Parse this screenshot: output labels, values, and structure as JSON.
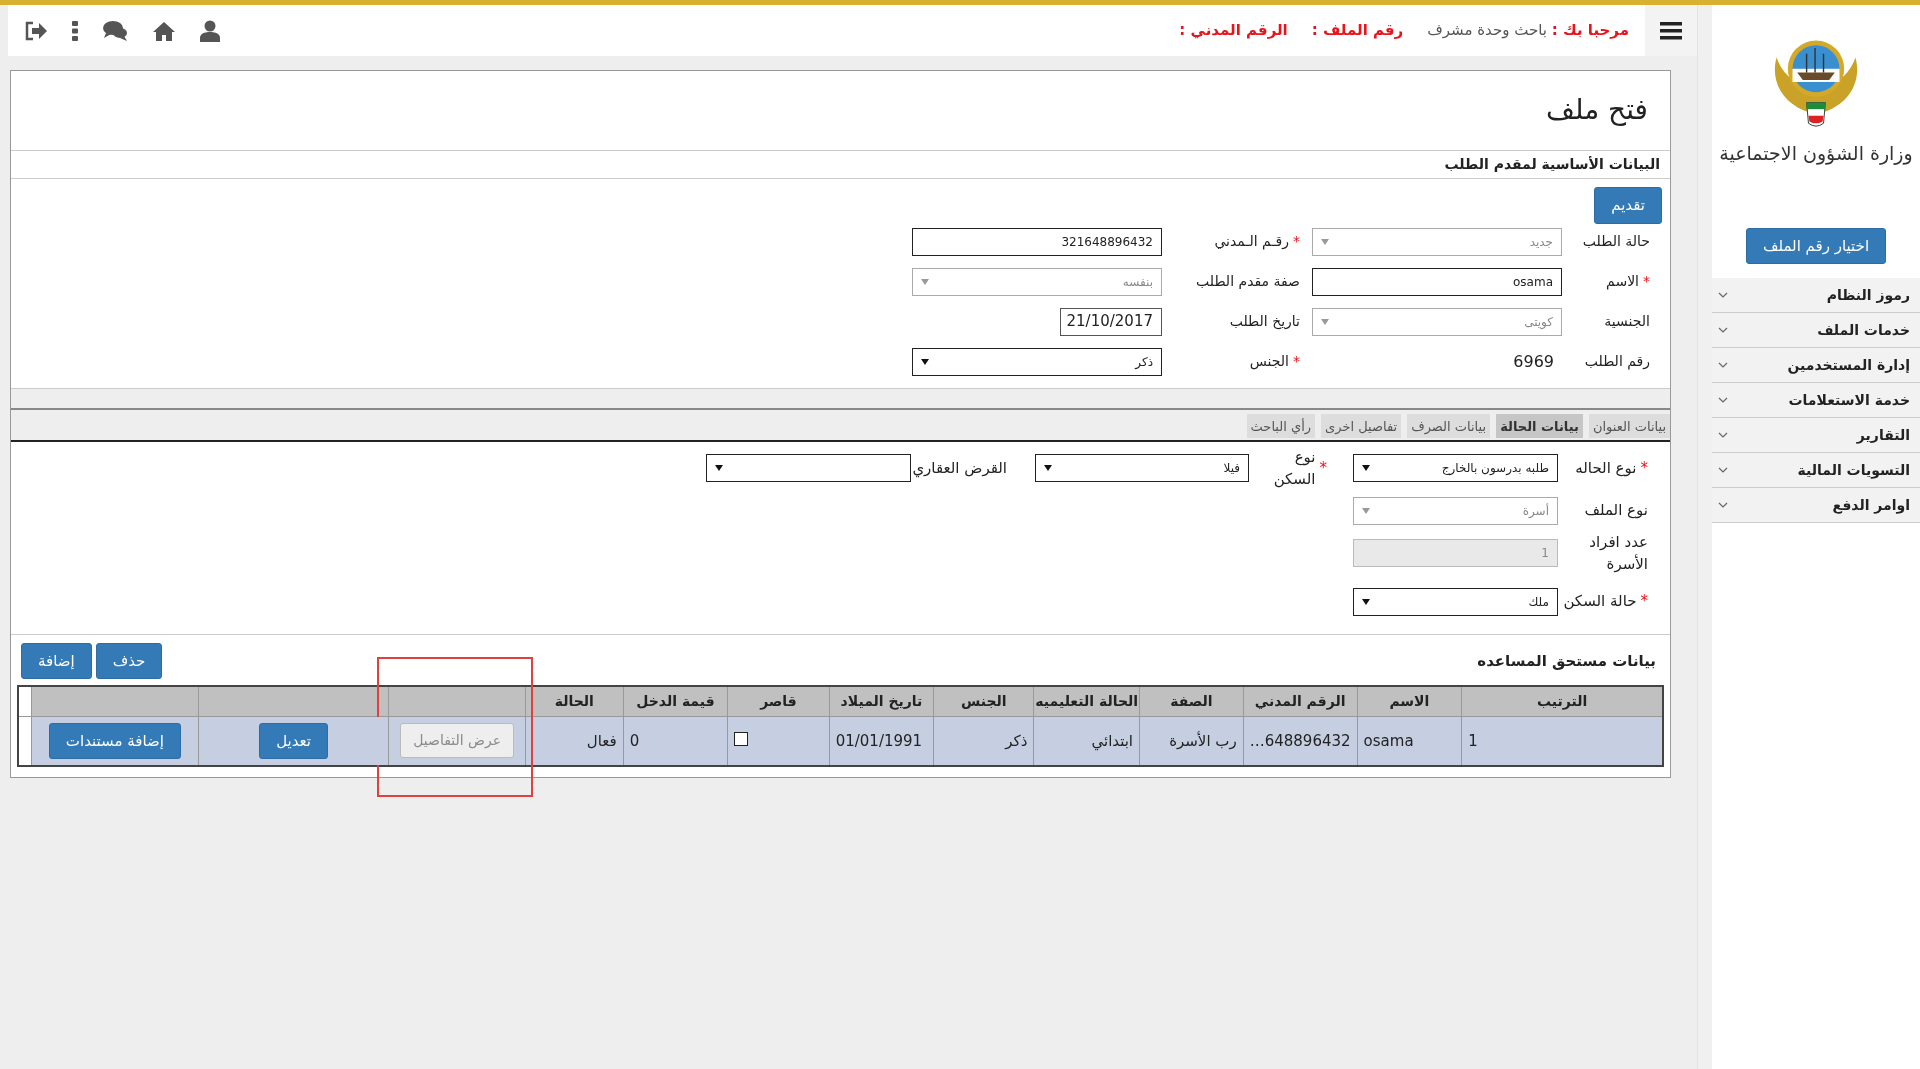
{
  "top_bar": {
    "welcome_label": "مرحبا بك :",
    "user_role": "باحث وحدة مشرف",
    "file_number_label": "رقم الملف :",
    "civil_id_label": "الرقم المدني :"
  },
  "sidebar": {
    "ministry_name": "وزارة الشؤون الاجتماعية",
    "select_file_button": "اختيار رقم الملف",
    "menu": [
      {
        "label": "رموز النظام"
      },
      {
        "label": "خدمات الملف"
      },
      {
        "label": "إدارة المستخدمين"
      },
      {
        "label": "خدمة الاستعلامات"
      },
      {
        "label": "التقارير"
      },
      {
        "label": "التسويات المالية"
      },
      {
        "label": "اوامر الدفع"
      }
    ]
  },
  "page": {
    "title": "فتح ملف",
    "section_title": "البيانات الأساسية لمقدم الطلب",
    "submit_button": "تقديم",
    "fields": [
      {
        "label": "حالة الطلب",
        "kind": "select",
        "value": "جديد",
        "disabled": true
      },
      {
        "label": "رقـم الـمدني",
        "required_mark": "*",
        "kind": "input",
        "value": "321648896432",
        "disabled": false
      },
      {
        "label": "الاسم",
        "required_mark": "*",
        "kind": "input",
        "value": "osama",
        "disabled": false
      },
      {
        "label": "صفة مقدم الطلب",
        "kind": "select",
        "value": "بنفسه",
        "disabled": true
      },
      {
        "label": "الجنسية",
        "kind": "select",
        "value": "كويتى",
        "disabled": true
      },
      {
        "label": "تاريخ الطلب",
        "kind": "date",
        "value": "21/10/2017"
      },
      {
        "label": "رقم الطلب",
        "kind": "static",
        "value": "6969"
      },
      {
        "label": "الجنس",
        "required_mark": "*",
        "kind": "select",
        "value": "ذكر",
        "disabled": false
      }
    ]
  },
  "tabs": [
    {
      "label": "بيانات العنوان",
      "selected": false
    },
    {
      "label": "بيانات الحالة",
      "selected": true
    },
    {
      "label": "بيانات الصرف",
      "selected": false
    },
    {
      "label": "تفاصيل اخرى",
      "selected": false
    },
    {
      "label": "رأي الباحث",
      "selected": false
    }
  ],
  "case_fields": [
    [
      {
        "label": "نوع الحاله",
        "required_mark": "*",
        "kind": "select",
        "value": "طلبه بدرسون بالخارج",
        "disabled": false
      },
      {
        "label": "نوع السكن",
        "required_mark": "*",
        "kind": "select",
        "value": "فيلا",
        "disabled": false
      },
      {
        "label": "القرض العقاري",
        "kind": "select",
        "disabled": false
      }
    ],
    [
      {
        "label": "نوع الملف",
        "kind": "select",
        "value": "أسرة",
        "disabled": true
      }
    ],
    [
      {
        "label": "عدد افراد الأسرة",
        "kind": "input",
        "value": "1",
        "disabled": true
      }
    ],
    [
      {
        "label": "حالة السكن",
        "required_mark": "*",
        "kind": "select",
        "value": "ملك",
        "disabled": false
      }
    ]
  ],
  "beneficiaries": {
    "title": "بيانات مستحق المساعده",
    "buttons": [
      "حذف",
      "إضافة"
    ],
    "columns": [
      "الترتيب",
      "الاسم",
      "الرقم المدني",
      "الصفة",
      "الحالة التعليميه",
      "الجنس",
      "تاريخ الميلاد",
      "قاصر",
      "قيمة الدخل",
      "الحالة"
    ],
    "rows": [
      {
        "cells": [
          {
            "kind": "text",
            "text": "1"
          },
          {
            "kind": "text",
            "text": "osama"
          },
          {
            "kind": "text",
            "text": "…648896432"
          },
          {
            "kind": "text",
            "text": "رب الأسرة"
          },
          {
            "kind": "text",
            "text": "ابتدائي"
          },
          {
            "kind": "text",
            "text": "ذكر"
          },
          {
            "kind": "text",
            "text": "01/01/1991"
          },
          {
            "kind": "checkbox",
            "checked": false
          },
          {
            "kind": "text",
            "text": "0"
          },
          {
            "kind": "text",
            "text": "فعال"
          },
          {
            "kind": "button",
            "text": "عرض التفاصيل",
            "disabled": true,
            "highlighted": true
          },
          {
            "kind": "button",
            "text": "تعديل",
            "disabled": false,
            "highlighted": false
          },
          {
            "kind": "button",
            "text": "إضافة مستندات",
            "disabled": false,
            "highlighted": false
          }
        ]
      }
    ]
  }
}
